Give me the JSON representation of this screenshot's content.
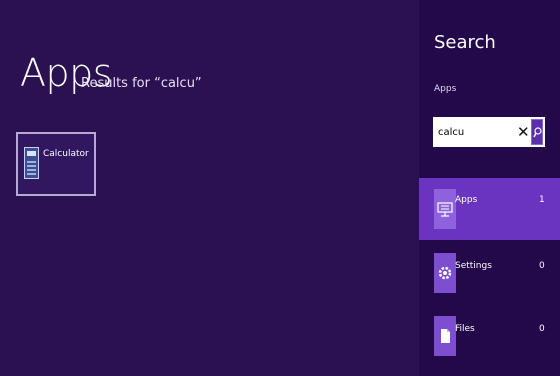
{
  "results": {
    "heading": "Apps",
    "results_for": "Results for “calcu”",
    "tiles": [
      {
        "label": "Calculator",
        "icon": "calculator-icon"
      }
    ]
  },
  "search_pane": {
    "title": "Search",
    "scope": "Apps",
    "query": "calcu",
    "clear_icon": "close-icon",
    "search_icon": "magnifier-icon",
    "items": [
      {
        "label": "Apps",
        "count": "1",
        "icon": "apps-icon",
        "selected": true
      },
      {
        "label": "Settings",
        "count": "0",
        "icon": "settings-gear-icon",
        "selected": false
      },
      {
        "label": "Files",
        "count": "0",
        "icon": "file-icon",
        "selected": false
      }
    ]
  },
  "colors": {
    "background": "#2b1152",
    "pane": "#24094a",
    "selected": "#6a34c0",
    "accent": "#7d4fd0"
  }
}
